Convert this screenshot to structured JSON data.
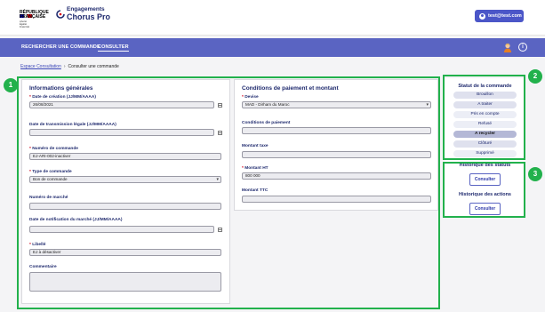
{
  "header": {
    "republic": "RÉPUBLIQUE\nFRANÇAISE",
    "motto": "Liberté\nÉgalité\nFraternité",
    "brand_line1": "Engagements",
    "brand_line2": "Chorus Pro",
    "user_email": "test@test.com",
    "user_icon": "user-icon"
  },
  "nav": {
    "items": [
      {
        "label": "RECHERCHER UNE COMMANDE"
      },
      {
        "label": "CONSULTER"
      }
    ],
    "info_glyph": "i"
  },
  "breadcrumb": {
    "root": "Espace Consultation",
    "current": "Consulter une commande"
  },
  "general": {
    "title": "Informations générales",
    "date_creation_label": "Date de création (JJ/MM/AAAA)",
    "date_creation_value": "26/08/2021",
    "date_transmission_label": "Date de transmission légale (JJ/MM/AAAA)",
    "date_transmission_value": "",
    "numero_label": "Numéro de commande",
    "numero_value": "EJ-ARI-002-inactiver",
    "type_label": "Type de commande",
    "type_value": "Bon de commande",
    "marche_label": "Numéro de marché",
    "marche_value": "",
    "notification_label": "Date de notification du marché (JJ/MM/AAAA)",
    "notification_value": "",
    "libelle_label": "Libellé",
    "libelle_value": "EJ à désactiver",
    "commentaire_label": "Commentaire",
    "required_mark": "*"
  },
  "payment": {
    "title": "Conditions de paiement et montant",
    "devise_label": "Devise",
    "devise_value": "MAD - Dirham du Maroc",
    "conditions_label": "Conditions de paiement",
    "conditions_value": "",
    "taxe_label": "Montant taxe",
    "taxe_value": "",
    "ht_label": "Montant HT",
    "ht_value": "800 000",
    "ttc_label": "Montant TTC",
    "ttc_value": ""
  },
  "status": {
    "title": "Statut de la commande",
    "items": [
      "Brouillon",
      "A traiter",
      "Pris en compte",
      "Refusé",
      "A recycler",
      "Clôturé",
      "Supprimé"
    ],
    "current": "A recycler"
  },
  "history": {
    "statuts_title": "Historique des statuts",
    "actions_title": "Historique des actions",
    "button_label": "Consulter"
  },
  "annotations": [
    "1",
    "2",
    "3"
  ],
  "colors": {
    "nav": "#5a64c2",
    "brand": "#1f2a6e",
    "annotation": "#22b14c",
    "required": "#d0021b"
  }
}
